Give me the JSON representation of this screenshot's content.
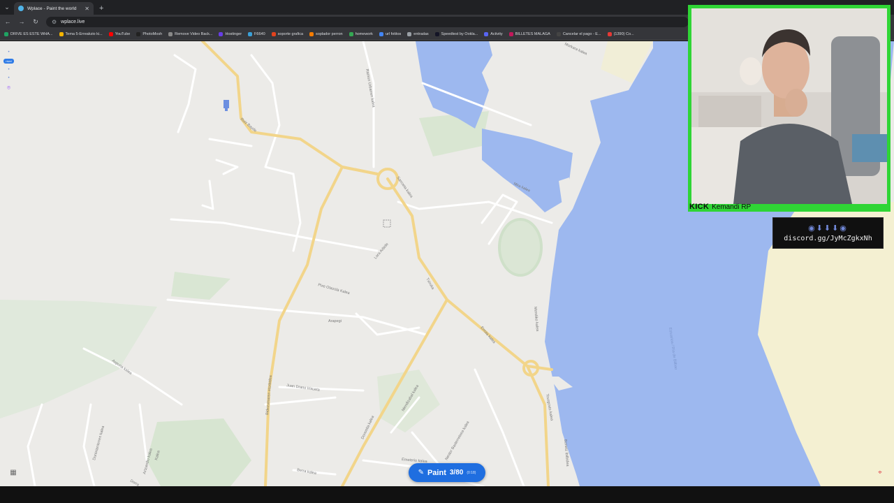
{
  "browser": {
    "tab_title": "Wplace - Paint the world",
    "url": "wplace.live",
    "bookmarks": [
      {
        "label": "DRIVE ES ESTE WHA...",
        "color": "#1fa463"
      },
      {
        "label": "Tema 5-Erreakzio ki...",
        "color": "#f4b400"
      },
      {
        "label": "YouTube",
        "color": "#ff0000"
      },
      {
        "label": "PhotoMosh",
        "color": "#222222"
      },
      {
        "label": "Remove Video Back...",
        "color": "#888888"
      },
      {
        "label": "Hostinger",
        "color": "#673de6"
      },
      {
        "label": "F6640",
        "color": "#3aa0d8"
      },
      {
        "label": "soporte grafica",
        "color": "#e2431e"
      },
      {
        "label": "soplador perron",
        "color": "#f57c00"
      },
      {
        "label": "homework",
        "color": "#34a853"
      },
      {
        "label": "url fotitos",
        "color": "#4285f4"
      },
      {
        "label": "entradas",
        "color": "#9aa0a6"
      },
      {
        "label": "Speedtest by Ookla...",
        "color": "#141526"
      },
      {
        "label": "Activity",
        "color": "#5865f2"
      },
      {
        "label": "BILLETES MALAGA",
        "color": "#c2185b"
      },
      {
        "label": "Cancelar el pago - E...",
        "color": "#444444"
      },
      {
        "label": "(1390) Co...",
        "color": "#e53935"
      }
    ]
  },
  "map": {
    "streets": [
      "Ramon Urbarren kalea",
      "Sarroeta kalea",
      "Ruiz Bayde",
      "Lora Arbide",
      "Txiruka",
      "Pixe Otazola Kalea",
      "Arapegi",
      "Errota kalea",
      "Donostia kalea",
      "Juan Drano Irisueta",
      "Bidezumaren etorbidea",
      "Aspuria kalea",
      "Dunixiarrierren kalea",
      "Artzandio kalea",
      "Nestor Basterretxea kalea",
      "Emeterio kalea",
      "Berra kalea",
      "Tourgosto kalea",
      "Mendiko kalea",
      "Mira kalea",
      "Morkara kalea",
      "Mendizabal kalea",
      "Estuarioa / Ría de Bilbao",
      "Kalea",
      "Bonetz ibilbidea",
      "Dorra"
    ]
  },
  "controls": {
    "left": {
      "pill_label": "nivel",
      "dot": "•",
      "twitch": "⌾"
    },
    "paint": {
      "icon": "✎",
      "label": "Paint",
      "count": "3/80",
      "timer": "(0:18)"
    },
    "layers_icon": "▦",
    "locate_icon": "⌖"
  },
  "overlay": {
    "brand": "KICK",
    "streamer": "Kemandi RP",
    "discord_icons": "◉⬇⬇⬇◉",
    "discord_link": "discord.gg/JyMcZgkxNh"
  },
  "colors": {
    "water": "#9db8ef",
    "land": "#ecebe8",
    "major_road": "#f2d58a",
    "park": "#d5e4cf",
    "sand": "#f3efcf",
    "paint_button": "#1f6ee0",
    "cam_border": "#2fd535"
  }
}
